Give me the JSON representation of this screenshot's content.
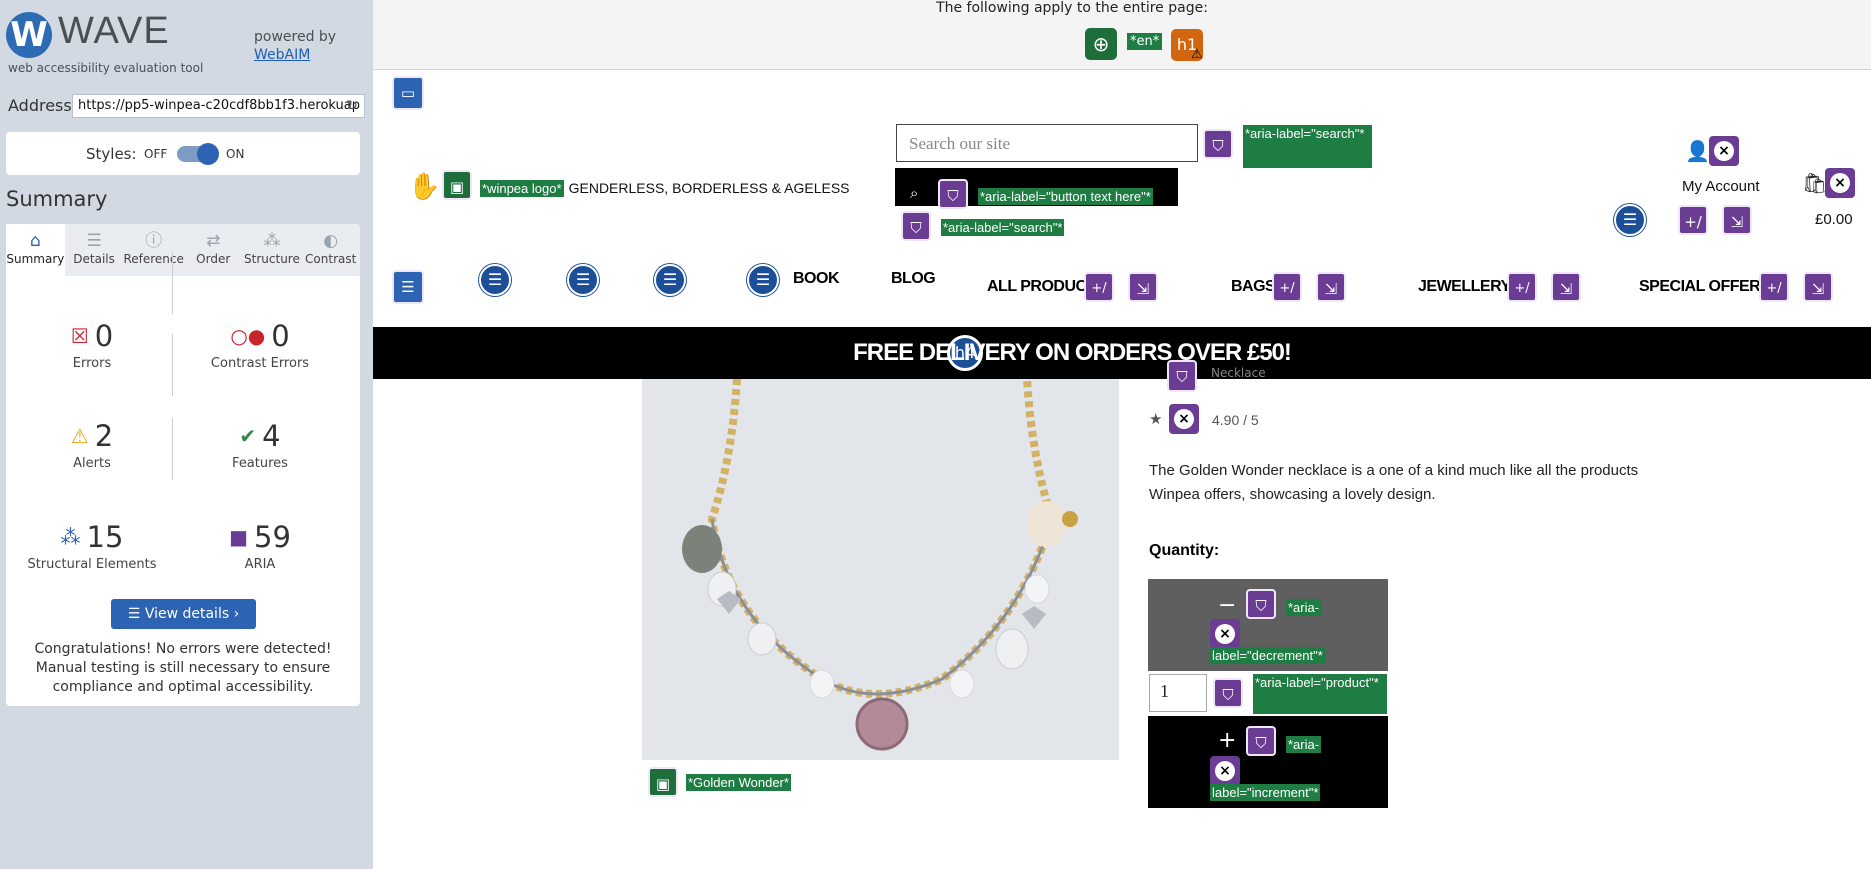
{
  "wave": {
    "logo_word": "WAVE",
    "tagline": "web accessibility evaluation tool",
    "powered_by": "powered by",
    "webaim_link": "WebAIM",
    "address_label": "Address:",
    "address_value": "https://pp5-winpea-c20cdf8bb1f3.herokuap",
    "styles_label": "Styles:",
    "styles_off": "OFF",
    "styles_on": "ON",
    "summary_title": "Summary",
    "tabs": [
      {
        "label": "Summary",
        "icon": "home-icon"
      },
      {
        "label": "Details",
        "icon": "list-icon"
      },
      {
        "label": "Reference",
        "icon": "info-icon"
      },
      {
        "label": "Order",
        "icon": "order-icon"
      },
      {
        "label": "Structure",
        "icon": "structure-icon"
      },
      {
        "label": "Contrast",
        "icon": "contrast-icon"
      }
    ],
    "stats": {
      "errors": {
        "count": "0",
        "label": "Errors"
      },
      "contrast_errors": {
        "count": "0",
        "label": "Contrast Errors"
      },
      "alerts": {
        "count": "2",
        "label": "Alerts"
      },
      "features": {
        "count": "4",
        "label": "Features"
      },
      "structural": {
        "count": "15",
        "label": "Structural Elements"
      },
      "aria": {
        "count": "59",
        "label": "ARIA"
      }
    },
    "view_details": "View details ›",
    "congrats": "Congratulations! No errors were detected! Manual testing is still necessary to ensure compliance and optimal accessibility."
  },
  "page": {
    "global_text": "The following apply to the entire page:",
    "lang_tag": "*en*",
    "h1_tag": "h1",
    "logo_aria": "*winpea logo*",
    "brand_slogan": "GENDERLESS, BORDERLESS & AGELESS",
    "search_placeholder": "Search our site",
    "aria_search_1": "*aria-label=\"search\"*",
    "aria_button_text": "*aria-label=\"button text here\"*",
    "aria_search_2": "*aria-label=\"search\"*",
    "my_account": "My Account",
    "cart_total": "£0.00",
    "nav": {
      "book": "BOOK",
      "blog": "BLOG",
      "all_products": "ALL PRODUCTS",
      "bags": "BAGS",
      "jewellery": "JEWELLERY",
      "special_offers": "SPECIAL OFFERS"
    },
    "promo_tag": "h4",
    "promo": "FREE DELIVERY ON ORDERS OVER £50!",
    "category_partial": "Necklace",
    "rating": "4.90 / 5",
    "description": "The Golden Wonder necklace is a one of a kind much like all the products Winpea offers, showcasing a lovely design.",
    "image_alt": "*Golden Wonder*",
    "quantity_label": "Quantity:",
    "minus": "−",
    "plus": "+",
    "aria_decrement_1": "*aria-",
    "aria_decrement_2": "label=\"decrement\"*",
    "quantity_value": "1",
    "aria_product": "*aria-label=\"product\"*",
    "aria_increment_1": "*aria-",
    "aria_increment_2": "label=\"increment\"*",
    "toggle_symbol": "+/−"
  },
  "colors": {
    "wave_blue": "#2d63b3",
    "aria_purple": "#6a3c93",
    "aria_green": "#1e7d43",
    "structure_blue": "#1c4f98",
    "alert_orange": "#d2660f"
  }
}
